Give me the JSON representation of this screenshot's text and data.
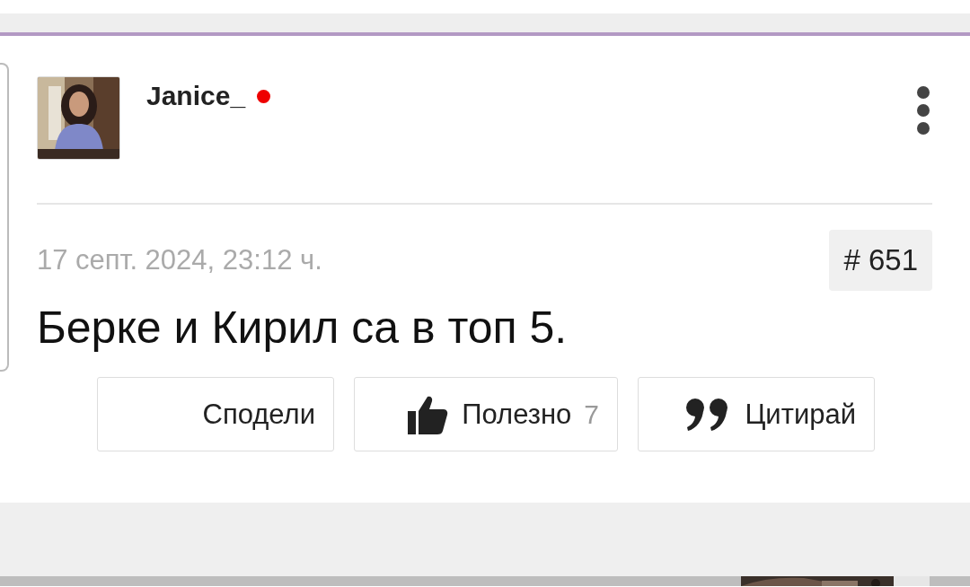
{
  "post": {
    "author": "Janice_",
    "online": true,
    "date": "17 септ. 2024, 23:12 ч.",
    "number": "# 651",
    "text": "Берке и Кирил са в топ 5.",
    "actions": [
      {
        "kind": "share",
        "label": "Сподели"
      },
      {
        "kind": "like",
        "label": "Полезно",
        "count": "7"
      },
      {
        "kind": "quote",
        "label": "Цитирай"
      }
    ]
  }
}
